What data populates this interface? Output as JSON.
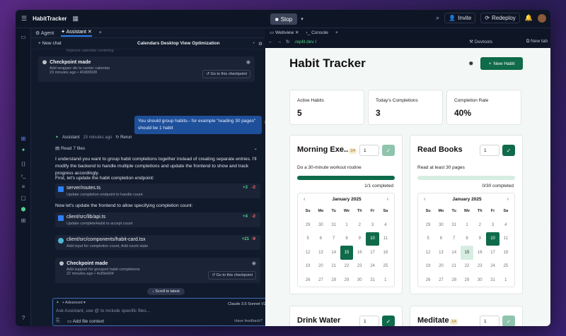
{
  "topbar": {
    "app_name": "HabitTracker",
    "stop_label": "Stop",
    "invite_label": "Invite",
    "redeploy_label": "Redeploy"
  },
  "left_tabs": {
    "agent": "Agent",
    "assistant": "Assistant"
  },
  "chat": {
    "new_chat": "New chat",
    "conversation_title": "Calendars Desktop View Optimization",
    "faded_line": "Improve calendar centering",
    "checkpoint1": {
      "title": "Checkpoint made",
      "desc": "Add wrapper div to center calendar",
      "meta": "23 minutes ago • 40d99028",
      "goto": "Go to this checkpoint"
    },
    "user_message": "You should group habits-- for example \"reading 30 pages\" should be 1 habit",
    "assistant_name": "Assistant",
    "assistant_time": "15 minutes ago",
    "rerun": "Rerun",
    "read_files": "Read 7 files",
    "para1": "I understand you want to group habit completions together instead of creating separate entries. I'll modify the backend to handle multiple completions and update the frontend to show and track progress accordingly.",
    "para2": "First, let's update the habit completion endpoint:",
    "para3": "Now let's update the frontend to allow specifying completion count:",
    "files": [
      {
        "name": "server/routes.ts",
        "desc": "Update completion endpoint to handle count",
        "add": "+3",
        "del": "-2"
      },
      {
        "name": "client/src/lib/api.ts",
        "desc": "Update completeHabit to accept count",
        "add": "+4",
        "del": "-2"
      },
      {
        "name": "client/src/components/habit-card.tsx",
        "desc": "Add input for completion count, Add count state",
        "add": "+21",
        "del": "-9"
      }
    ],
    "checkpoint2": {
      "title": "Checkpoint made",
      "desc": "Add support for grouped habit completions",
      "meta": "22 minutes ago • 4c89e604",
      "goto": "Go to this checkpoint"
    },
    "scroll_to_latest": "Scroll to latest",
    "composer": {
      "advanced": "Advanced",
      "model": "Claude 3.5 Sonnet V2",
      "placeholder": "Ask Assistant, use @ to include specific files...",
      "add_context": "Add file context",
      "feedback": "Have feedback?"
    }
  },
  "right_tabs": {
    "webview": "Webview",
    "console": "Console",
    "url": ".replit.dev",
    "path": "/",
    "devtools": "Devtools",
    "new_tab": "New tab"
  },
  "app": {
    "title": "Habit Tracker",
    "new_habit": "New Habit",
    "stats": [
      {
        "label": "Active Habits",
        "value": "5"
      },
      {
        "label": "Today's Completions",
        "value": "3"
      },
      {
        "label": "Completion Rate",
        "value": "40%"
      }
    ],
    "habits": [
      {
        "name": "Morning Exe...",
        "badge": "1/4",
        "qty": "1",
        "desc": "Do a 30-minute workout routine",
        "progress": 1.0,
        "count": "1/1 completed",
        "month": "January 2025"
      },
      {
        "name": "Read Books",
        "qty": "1",
        "desc": "Read at least 30 pages",
        "progress": 0.0,
        "count": "0/30 completed",
        "month": "January 2025"
      },
      {
        "name": "Drink Water",
        "qty": "1"
      },
      {
        "name": "Meditate",
        "badge": "1/4",
        "qty": "1"
      }
    ],
    "dow": [
      "Su",
      "Mo",
      "Tu",
      "We",
      "Th",
      "Fr",
      "Sa"
    ],
    "weeks": [
      [
        "29",
        "30",
        "31",
        "1",
        "2",
        "3",
        "4"
      ],
      [
        "5",
        "6",
        "7",
        "8",
        "9",
        "10",
        "11"
      ],
      [
        "12",
        "13",
        "14",
        "15",
        "16",
        "17",
        "18"
      ],
      [
        "19",
        "20",
        "21",
        "22",
        "23",
        "24",
        "25"
      ],
      [
        "26",
        "27",
        "28",
        "29",
        "30",
        "31",
        "1"
      ]
    ]
  },
  "colors": {
    "accent": "#0f6b4a",
    "link": "#2f7ff6",
    "bubble": "#1e4f9a"
  }
}
